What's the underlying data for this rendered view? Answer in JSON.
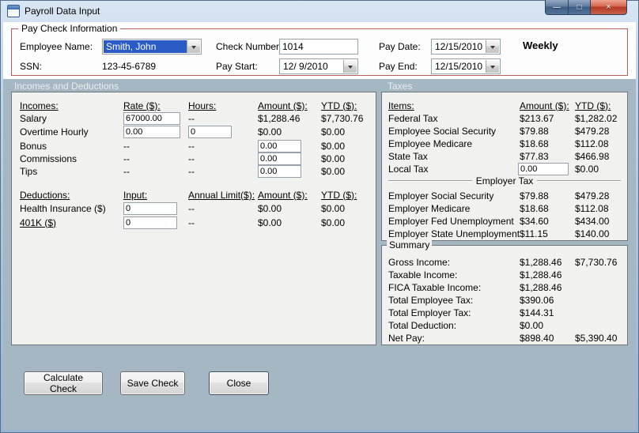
{
  "window": {
    "title": "Payroll Data Input"
  },
  "titlebar": {
    "minimize_glyph": "—",
    "maximize_glyph": "□",
    "close_glyph": "×"
  },
  "paycheck": {
    "group_label": "Pay Check Information",
    "employee_name": {
      "label": "Employee Name:",
      "value": "Smith, John"
    },
    "ssn": {
      "label": "SSN:",
      "value": "123-45-6789"
    },
    "check_number": {
      "label": "Check Number:",
      "value": "1014"
    },
    "pay_start": {
      "label": "Pay Start:",
      "value": "12/ 9/2010"
    },
    "pay_date": {
      "label": "Pay Date:",
      "value": "12/15/2010"
    },
    "pay_end": {
      "label": "Pay End:",
      "value": "12/15/2010"
    },
    "frequency": "Weekly"
  },
  "bands": {
    "incomes_deductions": "Incomes and Deductions",
    "taxes": "Taxes"
  },
  "incomes": {
    "headers": {
      "c0": "Incomes:",
      "c1": "Rate ($):",
      "c2": "Hours:",
      "c3": "Amount ($):",
      "c4": "YTD ($):"
    },
    "salary": {
      "label": "Salary",
      "rate": "67000.00",
      "hours": "--",
      "amount": "$1,288.46",
      "ytd": "$7,730.76"
    },
    "overtime": {
      "label": "Overtime Hourly",
      "rate": "0.00",
      "hours": "0",
      "amount": "$0.00",
      "ytd": "$0.00"
    },
    "bonus": {
      "label": "Bonus",
      "rate": "--",
      "hours": "--",
      "amount": "0.00",
      "ytd": "$0.00"
    },
    "commissions": {
      "label": "Commissions",
      "rate": "--",
      "hours": "--",
      "amount": "0.00",
      "ytd": "$0.00"
    },
    "tips": {
      "label": "Tips",
      "rate": "--",
      "hours": "--",
      "amount": "0.00",
      "ytd": "$0.00"
    }
  },
  "deductions": {
    "headers": {
      "c0": "Deductions:",
      "c1": "Input:",
      "c2": "Annual Limit($):",
      "c3": "Amount ($):",
      "c4": "YTD ($):"
    },
    "health": {
      "label": "Health Insurance  ($)",
      "input": "0",
      "limit": "--",
      "amount": "$0.00",
      "ytd": "$0.00"
    },
    "k401": {
      "label": "401K  ($)",
      "input": "0",
      "limit": "--",
      "amount": "$0.00",
      "ytd": "$0.00"
    }
  },
  "taxes": {
    "headers": {
      "c0": "Items:",
      "c1": "Amount ($):",
      "c2": "YTD ($):"
    },
    "federal": {
      "label": "Federal Tax",
      "amount": "$213.67",
      "ytd": "$1,282.02"
    },
    "emp_ss": {
      "label": "Employee Social Security",
      "amount": "$79.88",
      "ytd": "$479.28"
    },
    "emp_medicare": {
      "label": "Employee Medicare",
      "amount": "$18.68",
      "ytd": "$112.08"
    },
    "state": {
      "label": "State Tax",
      "amount": "$77.83",
      "ytd": "$466.98"
    },
    "local": {
      "label": "Local Tax",
      "amount": "0.00",
      "ytd": "$0.00"
    },
    "employer_divider": "Employer Tax",
    "er_ss": {
      "label": "Employer Social Security",
      "amount": "$79.88",
      "ytd": "$479.28"
    },
    "er_medicare": {
      "label": "Employer Medicare",
      "amount": "$18.68",
      "ytd": "$112.08"
    },
    "er_fed_unemp": {
      "label": "Employer Fed Unemployment",
      "amount": "$34.60",
      "ytd": "$434.00"
    },
    "er_state_unemp": {
      "label": "Employer State Unemployment",
      "amount": "$11.15",
      "ytd": "$140.00"
    }
  },
  "summary": {
    "group_label": "Summary",
    "gross": {
      "label": "Gross Income:",
      "amount": "$1,288.46",
      "ytd": "$7,730.76"
    },
    "taxable": {
      "label": "Taxable Income:",
      "amount": "$1,288.46",
      "ytd": ""
    },
    "fica": {
      "label": "FICA Taxable Income:",
      "amount": "$1,288.46",
      "ytd": ""
    },
    "total_emp_tax": {
      "label": "Total Employee Tax:",
      "amount": "$390.06",
      "ytd": ""
    },
    "total_er_tax": {
      "label": "Total Employer Tax:",
      "amount": "$144.31",
      "ytd": ""
    },
    "total_deduction": {
      "label": "Total Deduction:",
      "amount": "$0.00",
      "ytd": ""
    },
    "net_pay": {
      "label": "Net Pay:",
      "amount": "$898.40",
      "ytd": "$5,390.40"
    }
  },
  "buttons": {
    "calculate": "Calculate Check",
    "save": "Save Check",
    "close": "Close"
  },
  "colors": {
    "lower_background": "#A5B7C3",
    "paycheck_border": "#B4605E",
    "selection_blue": "#2B5CC5",
    "panel_background": "#F1F1EF"
  }
}
